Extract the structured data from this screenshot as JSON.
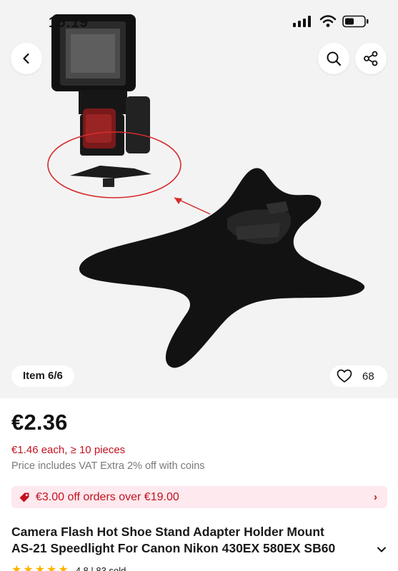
{
  "status_bar": {
    "time": "15:19"
  },
  "gallery": {
    "counter_label": "Item 6/6",
    "likes": "68",
    "icons": [
      "back-arrow-icon",
      "search-icon",
      "share-icon",
      "heart-icon"
    ]
  },
  "price": {
    "current": "€2.36",
    "bulk": "€1.46 each, ≥ 10 pieces",
    "vat_note": "Price includes VAT Extra 2% off with coins"
  },
  "promo": {
    "text": "€3.00 off orders over €19.00",
    "icon": "tag-icon",
    "color": "#c2121f",
    "background": "#fde9ee"
  },
  "product": {
    "title_line1": "Camera Flash Hot Shoe Stand Adapter Holder Mount",
    "title_line2": "AS-21 Speedlight For Canon Nikon 430EX 580EX SB60",
    "rating": "4.8 | 83 sold",
    "stars": 5
  }
}
